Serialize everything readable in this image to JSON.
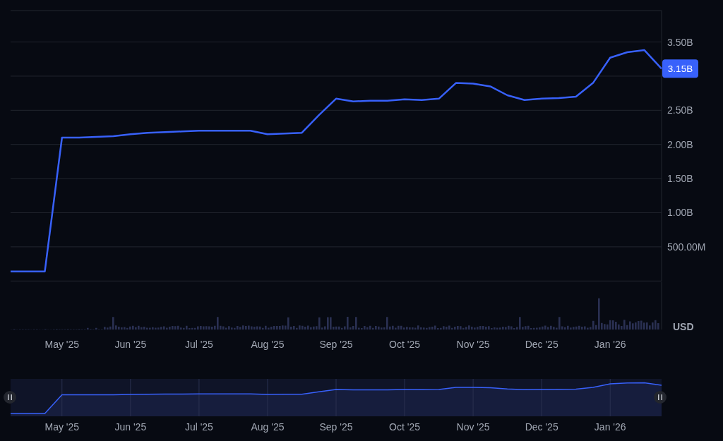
{
  "chart": {
    "chart_data": {
      "type": "line",
      "categories": [
        null,
        null,
        null,
        "May '25",
        null,
        null,
        null,
        "Jun '25",
        null,
        null,
        null,
        "Jul '25",
        null,
        null,
        null,
        "Aug '25",
        null,
        null,
        null,
        "Sep '25",
        null,
        null,
        null,
        "Oct '25",
        null,
        null,
        null,
        "Nov '25",
        null,
        null,
        null,
        "Dec '25",
        null,
        null,
        null,
        "Jan '26",
        null,
        null,
        null
      ],
      "series": [
        {
          "color": "#3861fb",
          "values": [
            140000000,
            140000000,
            140000000,
            2100000000,
            2100000000,
            2110000000,
            2120000000,
            2150000000,
            2170000000,
            2180000000,
            2190000000,
            2200000000,
            2200000000,
            2200000000,
            2200000000,
            2150000000,
            2160000000,
            2170000000,
            2430000000,
            2670000000,
            2630000000,
            2640000000,
            2640000000,
            2660000000,
            2650000000,
            2670000000,
            2900000000,
            2890000000,
            2850000000,
            2720000000,
            2650000000,
            2670000000,
            2680000000,
            2700000000,
            2900000000,
            3270000000,
            3350000000,
            3380000000,
            3110000000
          ]
        }
      ],
      "ylim": [
        -700000000,
        3960000000
      ],
      "grid": true,
      "yticks": [
        {
          "value": 500000000,
          "label": "500.00M"
        },
        {
          "value": 1000000000,
          "label": "1.00B"
        },
        {
          "value": 1500000000,
          "label": "1.50B"
        },
        {
          "value": 2000000000,
          "label": "2.00B"
        },
        {
          "value": 2500000000,
          "label": "2.50B"
        },
        {
          "value": 3500000000,
          "label": "3.50B"
        }
      ]
    },
    "currency_label": "USD",
    "price_badge": "3.15B"
  },
  "navigator": {
    "month_labels": [
      "May '25",
      "Jun '25",
      "Jul '25",
      "Aug '25",
      "Sep '25",
      "Oct '25",
      "Nov '25",
      "Dec '25",
      "Jan '26"
    ]
  }
}
